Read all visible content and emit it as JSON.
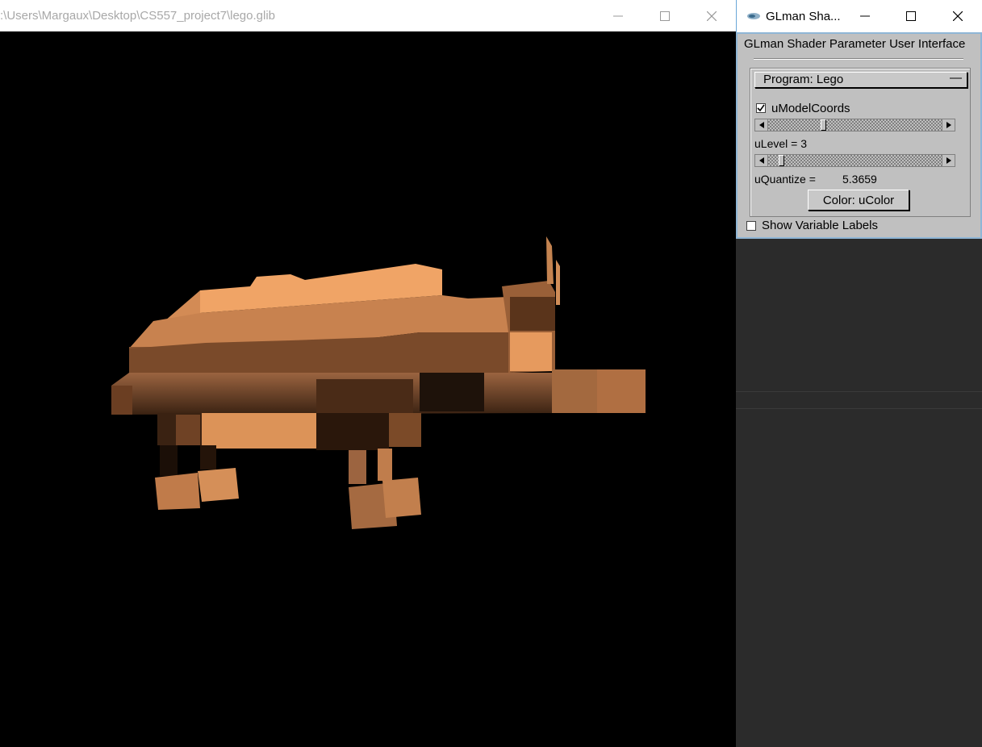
{
  "main_window": {
    "title": ":\\Users\\Margaux\\Desktop\\CS557_project7\\lego.glib"
  },
  "side_window": {
    "title": "GLman Sha...",
    "panel_header": "GLman Shader Parameter User Interface",
    "rollout": {
      "label": "Program: Lego",
      "collapse_symbol": "—"
    },
    "model_coords": {
      "label": "uModelCoords",
      "checked": true
    },
    "ulevel": {
      "label": "uLevel = 3",
      "value": 3,
      "slider_position": 0.36
    },
    "uquantize": {
      "label": "uQuantize =",
      "value": "5.3659",
      "slider_position": 0.05
    },
    "color_button_label": "Color: uColor",
    "show_labels": {
      "label": "Show Variable Labels",
      "checked": false
    }
  },
  "colors": {
    "background": "#000000",
    "panel": "#c0c0c0",
    "model_light": "#f4aa6a",
    "model_dark": "#1a0f08"
  },
  "icons": {
    "minimize": "minimize-icon",
    "maximize": "maximize-icon",
    "close": "close-icon",
    "app": "glman-app-icon"
  }
}
